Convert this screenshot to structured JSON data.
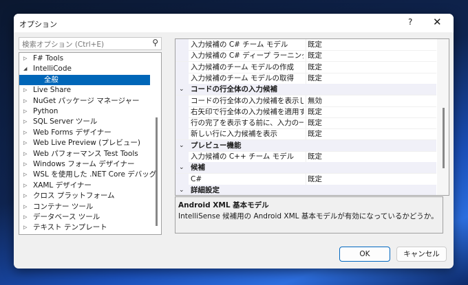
{
  "title": "オプション",
  "help": "?",
  "close": "✕",
  "search": {
    "placeholder": "検索オプション (Ctrl+E)",
    "icon": "⚲"
  },
  "tree": [
    {
      "label": "F# Tools",
      "arrow": "▷"
    },
    {
      "label": "IntelliCode",
      "arrow": "◢"
    },
    {
      "label": "全般",
      "arrow": "",
      "selected": true
    },
    {
      "label": "Live Share",
      "arrow": "▷"
    },
    {
      "label": "NuGet パッケージ マネージャー",
      "arrow": "▷"
    },
    {
      "label": "Python",
      "arrow": "▷"
    },
    {
      "label": "SQL Server ツール",
      "arrow": "▷"
    },
    {
      "label": "Web Forms デザイナー",
      "arrow": "▷"
    },
    {
      "label": "Web Live Preview (プレビュー)",
      "arrow": "▷"
    },
    {
      "label": "Web パフォーマンス Test Tools",
      "arrow": "▷"
    },
    {
      "label": "Windows フォーム デザイナー",
      "arrow": "▷"
    },
    {
      "label": "WSL を使用した .NET Core デバッグ",
      "arrow": "▷"
    },
    {
      "label": "XAML デザイナー",
      "arrow": "▷"
    },
    {
      "label": "クロス プラットフォーム",
      "arrow": "▷"
    },
    {
      "label": "コンテナー ツール",
      "arrow": "▷"
    },
    {
      "label": "データベース ツール",
      "arrow": "▷"
    },
    {
      "label": "テキスト テンプレート",
      "arrow": "▷"
    }
  ],
  "grid": [
    {
      "name": "入力候補の C# チーム モデル",
      "value": "既定"
    },
    {
      "name": "入力候補の C# ディープ ラーニング基本モデル",
      "value": "既定"
    },
    {
      "name": "入力候補のチーム モデルの作成",
      "value": "既定"
    },
    {
      "name": "入力候補のチーム モデルの取得",
      "value": "既定"
    },
    {
      "category": "コードの行全体の入力候補",
      "chevron": "⌄"
    },
    {
      "name": "コードの行全体の入力候補を表示します",
      "value": "無効"
    },
    {
      "name": "右矢印で行全体の入力候補を適用する",
      "value": "既定"
    },
    {
      "name": "行の完了を表示する前に、入力の一時停止",
      "value": "既定"
    },
    {
      "name": "新しい行に入力候補を表示",
      "value": "既定"
    },
    {
      "category": "プレビュー機能",
      "chevron": "⌄"
    },
    {
      "name": "入力候補の C++ チーム モデル",
      "value": "既定"
    },
    {
      "category": "候補",
      "chevron": "⌄"
    },
    {
      "name": "C#",
      "value": "既定"
    },
    {
      "category": "詳細設定",
      "chevron": "⌄"
    }
  ],
  "description": {
    "title": "Android XML 基本モデル",
    "text": "IntelliSense 候補用の Android XML 基本モデルが有効になっているかどうか。"
  },
  "buttons": {
    "ok": "OK",
    "cancel": "キャンセル"
  }
}
